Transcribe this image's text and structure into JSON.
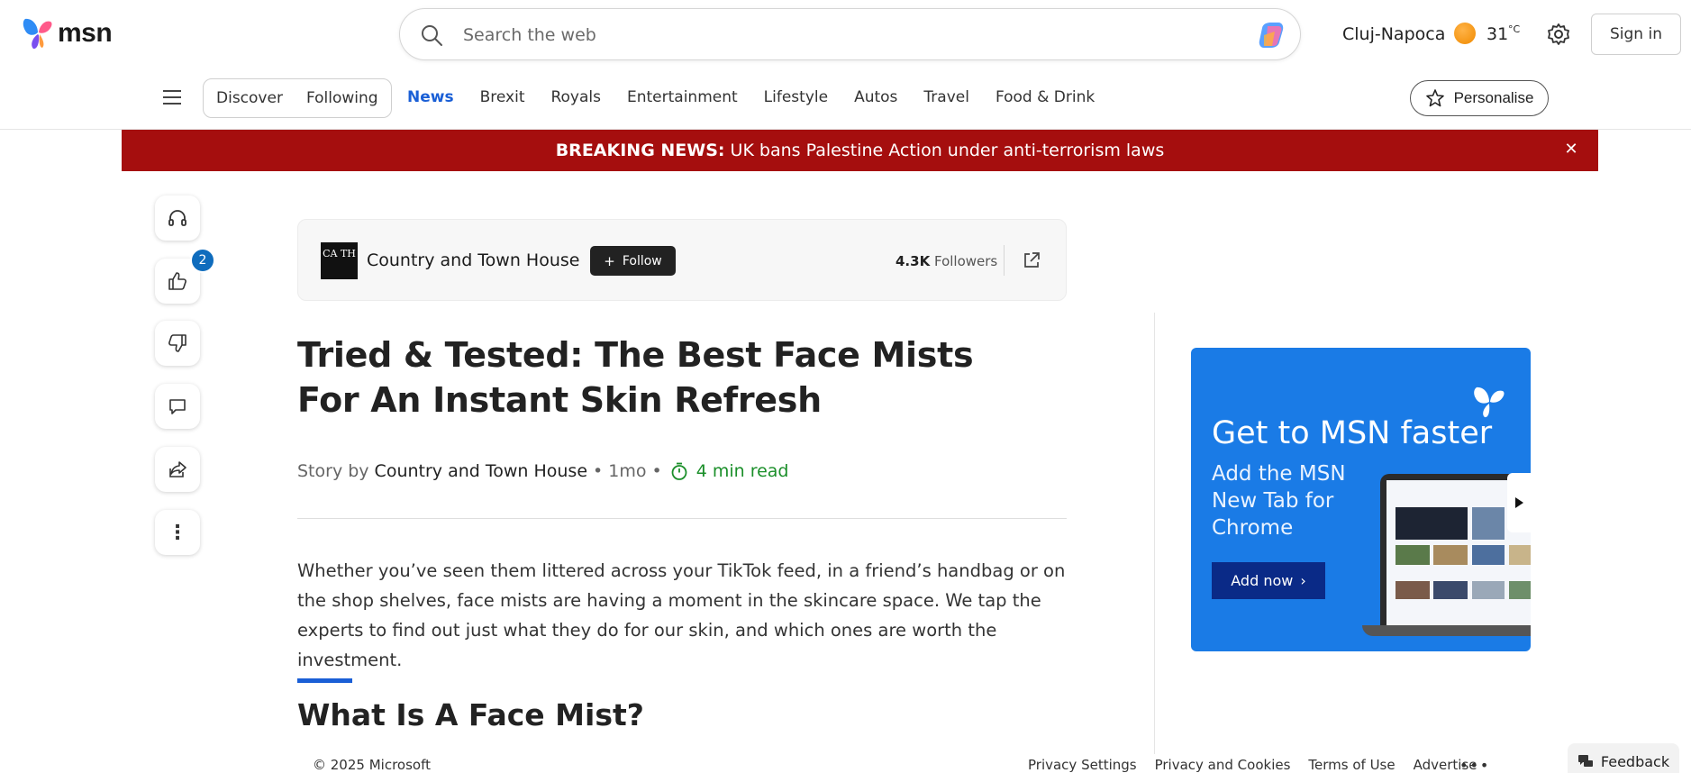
{
  "header": {
    "brand": "msn",
    "search_placeholder": "Search the web",
    "location": "Cluj-Napoca",
    "temperature": "31",
    "temperature_unit": "°C",
    "signin_label": "Sign in"
  },
  "nav": {
    "pills": [
      "Discover",
      "Following"
    ],
    "links": [
      "News",
      "Brexit",
      "Royals",
      "Entertainment",
      "Lifestyle",
      "Autos",
      "Travel",
      "Food & Drink"
    ],
    "active_link": "News",
    "personalise_label": "Personalise"
  },
  "breaking": {
    "label": "BREAKING NEWS:",
    "text": "UK bans Palestine Action under anti-terrorism laws",
    "close_glyph": "✕",
    "color": "#a50e0e"
  },
  "side_actions": {
    "like_count": "2",
    "more_glyph": "⋮"
  },
  "publisher": {
    "logo_text": "CA TH",
    "name": "Country and Town House",
    "follow_label": "Follow",
    "follow_glyph": "+",
    "followers_count": "4.3K",
    "followers_label": "Followers"
  },
  "article": {
    "title": "Tried & Tested: The Best Face Mists For An Instant Skin Refresh",
    "byline_prefix": "Story by",
    "author": "Country and Town House",
    "separator": "•",
    "age": "1mo",
    "read_time": "4 min read",
    "intro": "Whether you’ve seen them littered across your TikTok feed, in a friend’s handbag or on the shop shelves, face mists are having a moment in the skincare space. We tap the experts to find out just what they do for our skin, and which ones are worth the investment.",
    "section_heading": "What Is A Face Mist?"
  },
  "ad": {
    "title": "Get to MSN faster",
    "subtitle": "Add the MSN New Tab for Chrome",
    "button_label": "Add now",
    "button_glyph": "›",
    "color": "#1a7be6"
  },
  "footer": {
    "copyright": "© 2025 Microsoft",
    "links": [
      "Privacy Settings",
      "Privacy and Cookies",
      "Terms of Use",
      "Advertise"
    ],
    "more_glyph": "•••",
    "feedback_label": "Feedback"
  },
  "colors": {
    "accent": "#1a5fd6",
    "read_time": "#1b8f2a",
    "badge": "#0f6cbd"
  }
}
